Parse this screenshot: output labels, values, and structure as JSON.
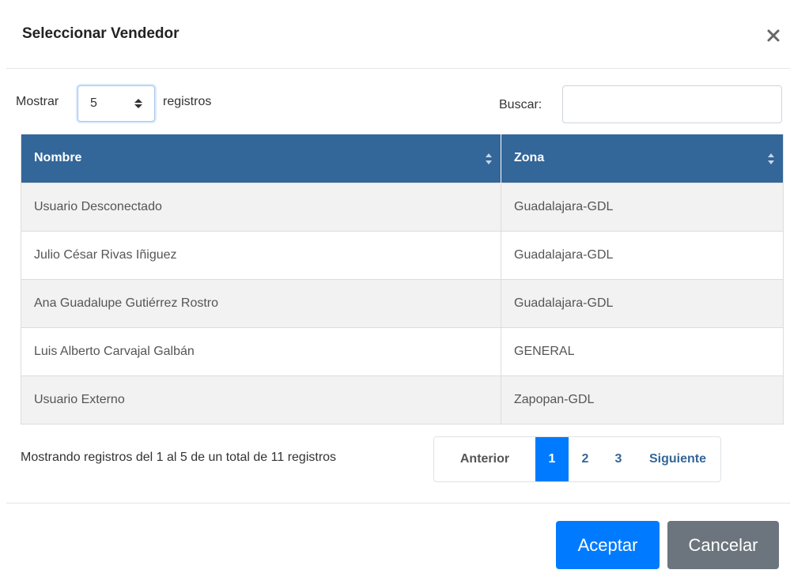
{
  "modal": {
    "title": "Seleccionar Vendedor",
    "close_icon": "close-icon"
  },
  "controls": {
    "show_label": "Mostrar",
    "page_length": "5",
    "records_label": "registros",
    "search_label": "Buscar:",
    "search_value": ""
  },
  "table": {
    "headers": [
      "Nombre",
      "Zona"
    ],
    "rows": [
      [
        "Usuario Desconectado",
        "Guadalajara-GDL"
      ],
      [
        "Julio César Rivas Iñiguez",
        "Guadalajara-GDL"
      ],
      [
        "Ana Guadalupe Gutiérrez Rostro",
        "Guadalajara-GDL"
      ],
      [
        "Luis Alberto Carvajal Galbán",
        "GENERAL"
      ],
      [
        "Usuario Externo",
        "Zapopan-GDL"
      ]
    ]
  },
  "info": "Mostrando registros del 1 al 5 de un total de 11 registros",
  "pagination": {
    "prev": "Anterior",
    "pages": [
      "1",
      "2",
      "3"
    ],
    "active_page": "1",
    "next": "Siguiente"
  },
  "footer": {
    "accept": "Aceptar",
    "cancel": "Cancelar"
  },
  "colors": {
    "header_bg": "#336699",
    "primary": "#007bff",
    "secondary": "#6c757d"
  }
}
